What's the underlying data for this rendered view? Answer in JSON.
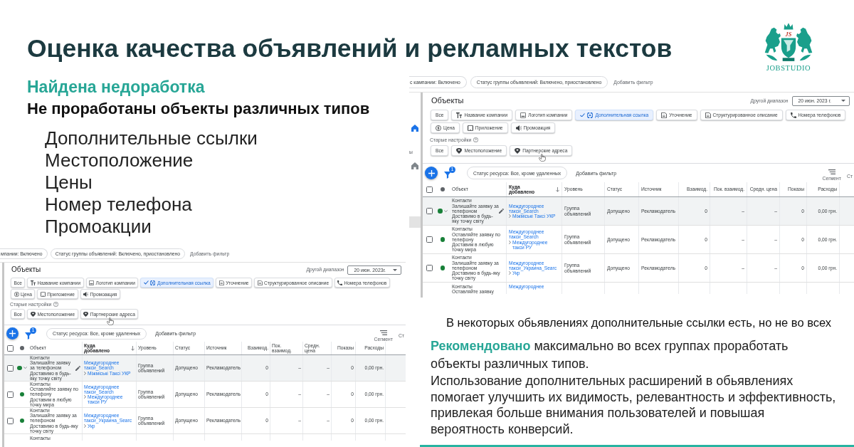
{
  "slide": {
    "title": "Оценка качества объявлений и рекламных текстов",
    "logo": {
      "monogram": "JS",
      "wordmark": "JOBSTUDIO"
    }
  },
  "left_panel": {
    "finding": {
      "label": "Найдена недоработка",
      "heading": "Не проработаны объекты различных типов",
      "items": [
        "Дополнительные ссылки",
        "Местоположение",
        "Цены",
        "Номер телефона",
        "Промоакции"
      ]
    },
    "screenshot": {
      "filters": [
        {
          "label": "мпании: Включено",
          "cut": true
        },
        {
          "label": "Статус группы объявлений: Включено, приостановлено",
          "cut": false
        }
      ],
      "add_filter": "Добавить фильтр",
      "title": "Объекты",
      "range_label": "Другой диапазон",
      "date": "20 июн. 2023г.",
      "type_chips": [
        [
          {
            "label": "Все",
            "kind": "plain",
            "selected": false
          },
          {
            "label": "Название компании",
            "kind": "text",
            "selected": false
          },
          {
            "label": "Логотип компании",
            "kind": "image",
            "selected": false
          },
          {
            "label": "Дополнительная ссылка",
            "kind": "link",
            "selected": true
          },
          {
            "label": "Уточнение",
            "kind": "document",
            "selected": false
          },
          {
            "label": "Структурированное описание",
            "kind": "document",
            "selected": false
          },
          {
            "label": "Номера телефонов",
            "kind": "phone",
            "selected": false
          }
        ],
        [
          {
            "label": "Цена",
            "kind": "price",
            "selected": false
          },
          {
            "label": "Приложение",
            "kind": "app",
            "selected": false
          },
          {
            "label": "Промоакция",
            "kind": "promo",
            "selected": false
          }
        ]
      ],
      "legacy": {
        "label": "Старые настройки",
        "chips": [
          {
            "label": "Все",
            "kind": "plain",
            "hovered": false
          },
          {
            "label": "Местоположение",
            "kind": "pin",
            "hovered": false
          },
          {
            "label": "Партнерские адреса",
            "kind": "pin",
            "hovered": true
          }
        ]
      },
      "toolbar": {
        "filter_count": "1",
        "status_chip": "Статус ресурса: Все, кроме удаленных",
        "add_filter": "Добавить фильтр",
        "segment": "Сегмент",
        "columns_cut": "Ст"
      },
      "table": {
        "all_checked": false,
        "columns": [
          {
            "label": "Объект",
            "kind": "text",
            "sorted": false
          },
          {
            "label": "Куда добавлено",
            "kind": "text",
            "sorted": true
          },
          {
            "label": "Уровень",
            "kind": "text",
            "sorted": false
          },
          {
            "label": "Статус",
            "kind": "text",
            "sorted": false
          },
          {
            "label": "Источник",
            "kind": "text",
            "sorted": false
          },
          {
            "label": "Взаимод.",
            "kind": "number",
            "sorted": false
          },
          {
            "label": "Пок. взаимод.",
            "kind": "number",
            "sorted": false
          },
          {
            "label": "Средн. цена",
            "kind": "number",
            "sorted": false
          },
          {
            "label": "Показы",
            "kind": "number",
            "sorted": false
          },
          {
            "label": "Расходы",
            "kind": "number",
            "sorted": false
          }
        ],
        "rows": [
          {
            "checked": false,
            "color": "#188038",
            "hovered": true,
            "sitelink": {
              "title": "Контакти",
              "lines": [
                "Залишайте заявку за телефоном",
                "Доставимо в будь-яку точку світу"
              ]
            },
            "destination": {
              "campaign": "Междугороднее такси_Search",
              "ad_group": "Міжміські Таксі УКР"
            },
            "values": [
              "Группа объявлений",
              "Допущено",
              "Рекламодатель",
              "0",
              "–",
              "–",
              "0",
              "0,00 грн."
            ]
          },
          {
            "checked": false,
            "color": "#188038",
            "hovered": false,
            "sitelink": {
              "title": "Контакты",
              "lines": [
                "Оставляйте заявку по телефону",
                "Доставим в любую точку мира"
              ]
            },
            "destination": {
              "campaign": "Междугороднее такси_Search",
              "ad_group": "Междугороднее такси РУ"
            },
            "values": [
              "Группа объявлений",
              "Допущено",
              "Рекламодатель",
              "0",
              "–",
              "–",
              "0",
              "0,00 грн."
            ]
          },
          {
            "checked": false,
            "color": "#188038",
            "hovered": false,
            "sitelink": {
              "title": "Контакти",
              "lines": [
                "Залишайте заявку за телефоном",
                "Доставимо в будь-яку точку світу"
              ]
            },
            "destination": {
              "campaign": "Междугороднее такси_Украина_Searc",
              "ad_group": "Укр"
            },
            "values": [
              "Группа объявлений",
              "Допущено",
              "Рекламодатель",
              "0",
              "–",
              "–",
              "0",
              "0,00 грн."
            ]
          },
          {
            "sitelink": {
              "title": "Контакты"
            }
          }
        ]
      }
    }
  },
  "right_panel": {
    "screenshot": {
      "filters": [
        {
          "label": "с кампании: Включено",
          "cut": true
        },
        {
          "label": "Статус группы объявлений: Включено, приостановлено",
          "cut": false
        }
      ],
      "add_filter": "Добавить фильтр",
      "sidebar": [
        {
          "kind": "home",
          "selected": true
        },
        {
          "kind": "label",
          "label": "ы",
          "selected": false
        },
        {
          "kind": "home",
          "selected": false
        },
        {
          "kind": "blank",
          "selected": true
        }
      ],
      "title": "Объекты",
      "range_label": "Другой диапазон",
      "date": "20 июн. 2023 г.",
      "type_chips": [
        [
          {
            "label": "Все",
            "kind": "plain",
            "selected": false
          },
          {
            "label": "Название компании",
            "kind": "text",
            "selected": false
          },
          {
            "label": "Логотип компании",
            "kind": "image",
            "selected": false
          },
          {
            "label": "Дополнительная ссылка",
            "kind": "link",
            "selected": true
          },
          {
            "label": "Уточнение",
            "kind": "document",
            "selected": false
          },
          {
            "label": "Структурированное описание",
            "kind": "document",
            "selected": false
          },
          {
            "label": "Номера телефонов",
            "kind": "phone",
            "selected": false
          }
        ],
        [
          {
            "label": "Цена",
            "kind": "price",
            "selected": false
          },
          {
            "label": "Приложение",
            "kind": "app",
            "selected": false
          },
          {
            "label": "Промоакция",
            "kind": "promo",
            "selected": false
          }
        ]
      ],
      "legacy": {
        "label": "Старые настройки",
        "chips": [
          {
            "label": "Все",
            "kind": "plain",
            "hovered": false
          },
          {
            "label": "Местоположение",
            "kind": "pin",
            "hovered": false
          },
          {
            "label": "Партнерские адреса",
            "kind": "pin",
            "hovered": true
          }
        ]
      },
      "toolbar": {
        "filter_count": "1",
        "status_chip": "Статус ресурса: Все, кроме удаленных",
        "add_filter": "Добавить фильтр",
        "segment": "Сегмент",
        "columns_cut": "Ст"
      },
      "table": {
        "all_checked": false,
        "columns": [
          {
            "label": "Объект",
            "kind": "text",
            "sorted": false
          },
          {
            "label": "Куда добавлено",
            "kind": "text",
            "sorted": true
          },
          {
            "label": "Уровень",
            "kind": "text",
            "sorted": false
          },
          {
            "label": "Статус",
            "kind": "text",
            "sorted": false
          },
          {
            "label": "Источник",
            "kind": "text",
            "sorted": false
          },
          {
            "label": "Взаимод.",
            "kind": "number",
            "sorted": false
          },
          {
            "label": "Пок. взаимод.",
            "kind": "number",
            "sorted": false
          },
          {
            "label": "Средн. цена",
            "kind": "number",
            "sorted": false
          },
          {
            "label": "Показы",
            "kind": "number",
            "sorted": false
          },
          {
            "label": "Расходы",
            "kind": "number",
            "sorted": false
          }
        ],
        "rows": [
          {
            "checked": false,
            "color": "#188038",
            "hovered": true,
            "sitelink": {
              "title": "Контакти",
              "lines": [
                "Залишайте заявку за телефоном",
                "Доставимо в будь-яку точку світу"
              ]
            },
            "destination": {
              "campaign": "Междугороднее такси_Search",
              "ad_group": "Міжміські Таксі УКР"
            },
            "values": [
              "Группа объявлений",
              "Допущено",
              "Рекламодатель",
              "0",
              "–",
              "–",
              "0",
              "0,00 грн."
            ]
          },
          {
            "checked": false,
            "color": "#188038",
            "hovered": false,
            "sitelink": {
              "title": "Контакты",
              "lines": [
                "Оставляйте заявку по телефону",
                "Доставим в любую точку мира"
              ]
            },
            "destination": {
              "campaign": "Междугороднее такси_Search",
              "ad_group": "Междугороднее такси РУ"
            },
            "values": [
              "Группа объявлений",
              "Допущено",
              "Рекламодатель",
              "0",
              "–",
              "–",
              "0",
              "0,00 грн."
            ]
          },
          {
            "checked": false,
            "color": "#188038",
            "hovered": false,
            "sitelink": {
              "title": "Контакти",
              "lines": [
                "Залишайте заявку за телефоном",
                "Доставимо в будь-яку точку світу"
              ]
            },
            "destination": {
              "campaign": "Междугороднее такси_Украина_Searc",
              "ad_group": "Укр"
            },
            "values": [
              "Группа объявлений",
              "Допущено",
              "Рекламодатель",
              "0",
              "–",
              "–",
              "0",
              "0,00 грн."
            ]
          },
          {
            "sitelink": {
              "title": "Контакты",
              "lines": [
                "Оставляйте заявку"
              ]
            },
            "destination": {
              "campaign": "Междугороднее"
            }
          }
        ]
      }
    },
    "caption": "В некоторых обьявлениях дополнительные ссылки есть, но не во всех",
    "recommendation": {
      "summary": "**Рекомендовано** максимально во всех группах проработать объекты различных типов.",
      "details": "Использование дополнительных расширений в обьявлениях помогает улучшить их видимость, релевантность и эффективность, привлекая больше внимания пользователей и повышая вероятность конверсий."
    }
  }
}
